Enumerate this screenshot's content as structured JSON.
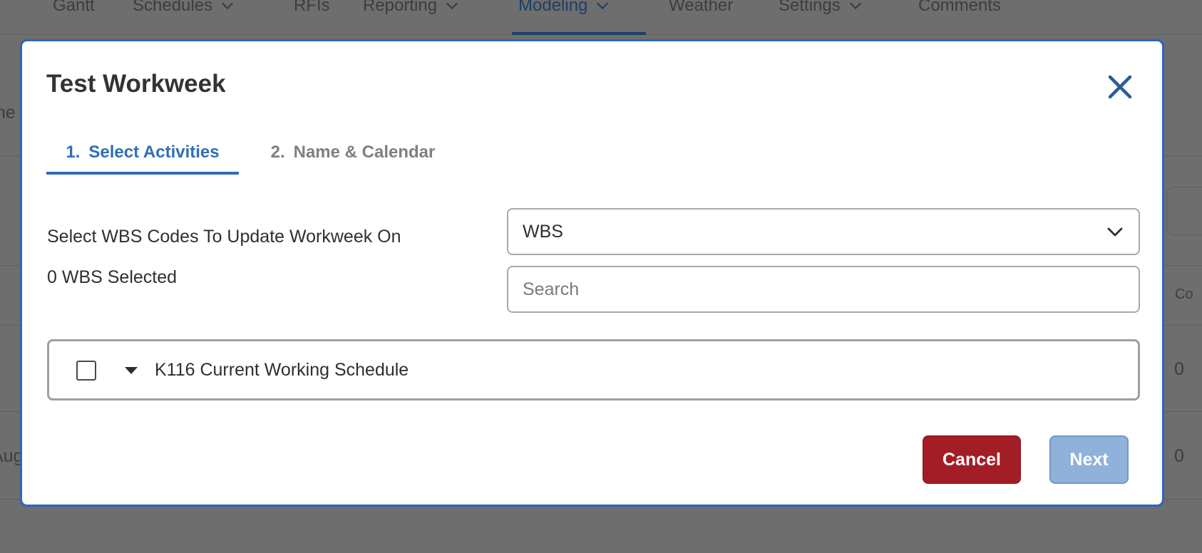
{
  "background": {
    "nav": [
      {
        "label": "Gantt",
        "chevron": false
      },
      {
        "label": "Schedules",
        "chevron": true
      },
      {
        "label": "RFIs",
        "chevron": false
      },
      {
        "label": "Reporting",
        "chevron": true
      },
      {
        "label": "Modeling",
        "chevron": true,
        "active": true
      },
      {
        "label": "Weather",
        "chevron": false
      },
      {
        "label": "Settings",
        "chevron": true
      },
      {
        "label": "Comments",
        "chevron": false
      }
    ],
    "fragments": {
      "left_he": "he",
      "left_aug": "Aug",
      "col_header": "Co",
      "row1_value": "0",
      "row2_value": "0"
    }
  },
  "modal": {
    "title": "Test Workweek",
    "close_icon": "close-icon",
    "tabs": [
      {
        "number": "1.",
        "label": "Select Activities",
        "active": true
      },
      {
        "number": "2.",
        "label": "Name & Calendar",
        "active": false
      }
    ],
    "wbs_label": "Select WBS Codes To Update Workweek On",
    "selected_count": "0 WBS Selected",
    "select": {
      "value": "WBS",
      "icon": "chevron-down-icon"
    },
    "search": {
      "value": "",
      "placeholder": "Search"
    },
    "tree": {
      "items": [
        {
          "label": "K116 Current Working Schedule",
          "checked": false,
          "expanded": true
        }
      ]
    },
    "buttons": {
      "cancel": "Cancel",
      "next": "Next"
    }
  },
  "colors": {
    "accent": "#2f6fb5",
    "modal_border": "#2a66b8",
    "cancel": "#a31d27",
    "next_disabled": "#8fb1da",
    "overlay": "#6e6e6e"
  }
}
